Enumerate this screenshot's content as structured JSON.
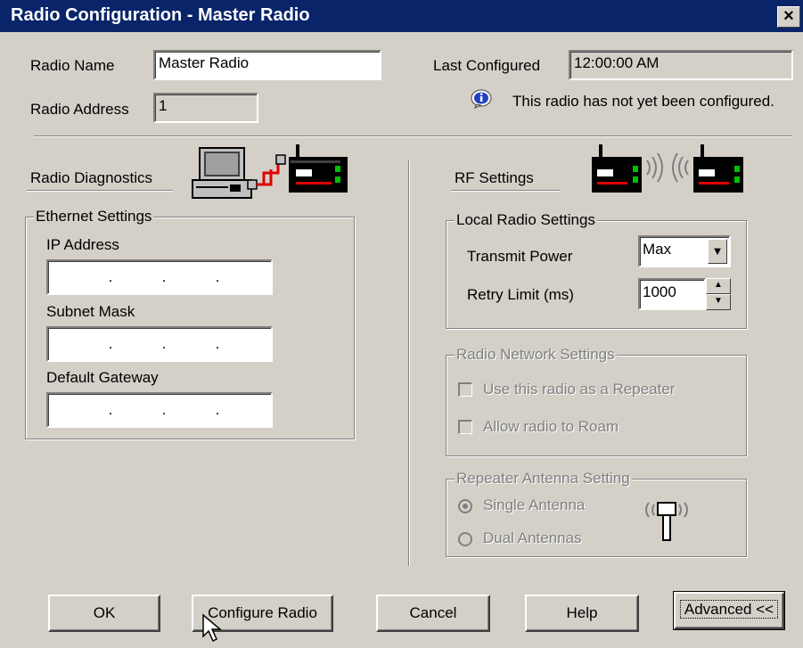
{
  "window": {
    "title": "Radio Configuration - Master Radio",
    "close_glyph": "×"
  },
  "radio_name": {
    "label": "Radio Name",
    "value": "Master Radio"
  },
  "radio_address": {
    "label": "Radio Address",
    "value": "1"
  },
  "last_configured": {
    "label": "Last Configured",
    "value": "12:00:00 AM"
  },
  "info": {
    "icon": "info-icon",
    "message": "This radio has not yet been configured."
  },
  "diagnostics": {
    "label": "Radio Diagnostics",
    "icon": "computer-radio-icon"
  },
  "ethernet": {
    "title": "Ethernet Settings",
    "ip_label": "IP Address",
    "subnet_label": "Subnet Mask",
    "gateway_label": "Default Gateway",
    "dots": ".  .  ."
  },
  "rf": {
    "label": "RF Settings",
    "icon": "radio-link-icon"
  },
  "local": {
    "title": "Local Radio Settings",
    "power_label": "Transmit Power",
    "power_value": "Max",
    "retry_label": "Retry Limit (ms)",
    "retry_value": "1000"
  },
  "network": {
    "title": "Radio Network Settings",
    "repeater_label": "Use this radio as a Repeater",
    "roam_label": "Allow radio to Roam"
  },
  "antenna": {
    "title": "Repeater Antenna Setting",
    "single_label": "Single Antenna",
    "dual_label": "Dual Antennas",
    "selected": "Single Antenna"
  },
  "buttons": {
    "ok": "OK",
    "configure": "Configure Radio",
    "cancel": "Cancel",
    "help": "Help",
    "advanced": "Advanced <<"
  },
  "colors": {
    "titlebar": "#0a246a",
    "face": "#d4d0c8",
    "cable": "#e00000",
    "led": "#00c000"
  }
}
